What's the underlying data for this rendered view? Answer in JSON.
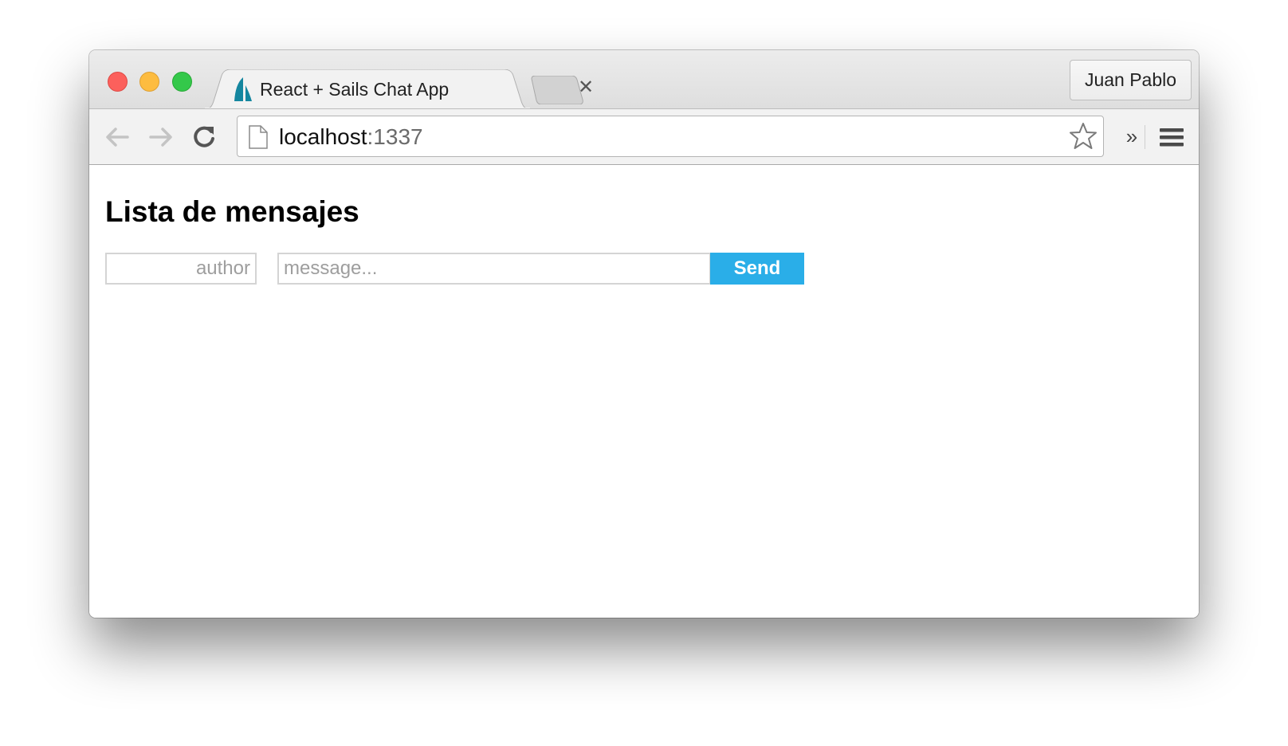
{
  "window": {
    "profile_name": "Juan Pablo"
  },
  "tabs": [
    {
      "title": "React + Sails Chat App",
      "favicon": "sails-logo-icon",
      "active": true
    }
  ],
  "toolbar": {
    "url_host": "localhost",
    "url_port": ":1337",
    "icons": [
      "back-arrow-icon",
      "forward-arrow-icon",
      "reload-icon",
      "page-icon",
      "star-icon",
      "chevron-double-right-icon",
      "hamburger-menu-icon"
    ],
    "overflow_symbol": "»",
    "tab_close_symbol": "✕"
  },
  "page": {
    "heading": "Lista de mensajes",
    "author_placeholder": "author",
    "message_placeholder": "message...",
    "send_label": "Send"
  },
  "colors": {
    "send_button": "#2aaee8",
    "sails_logo": "#14869f",
    "close_red": "#fc605c",
    "minimize_yellow": "#fdbc40",
    "zoom_green": "#34c84a"
  }
}
